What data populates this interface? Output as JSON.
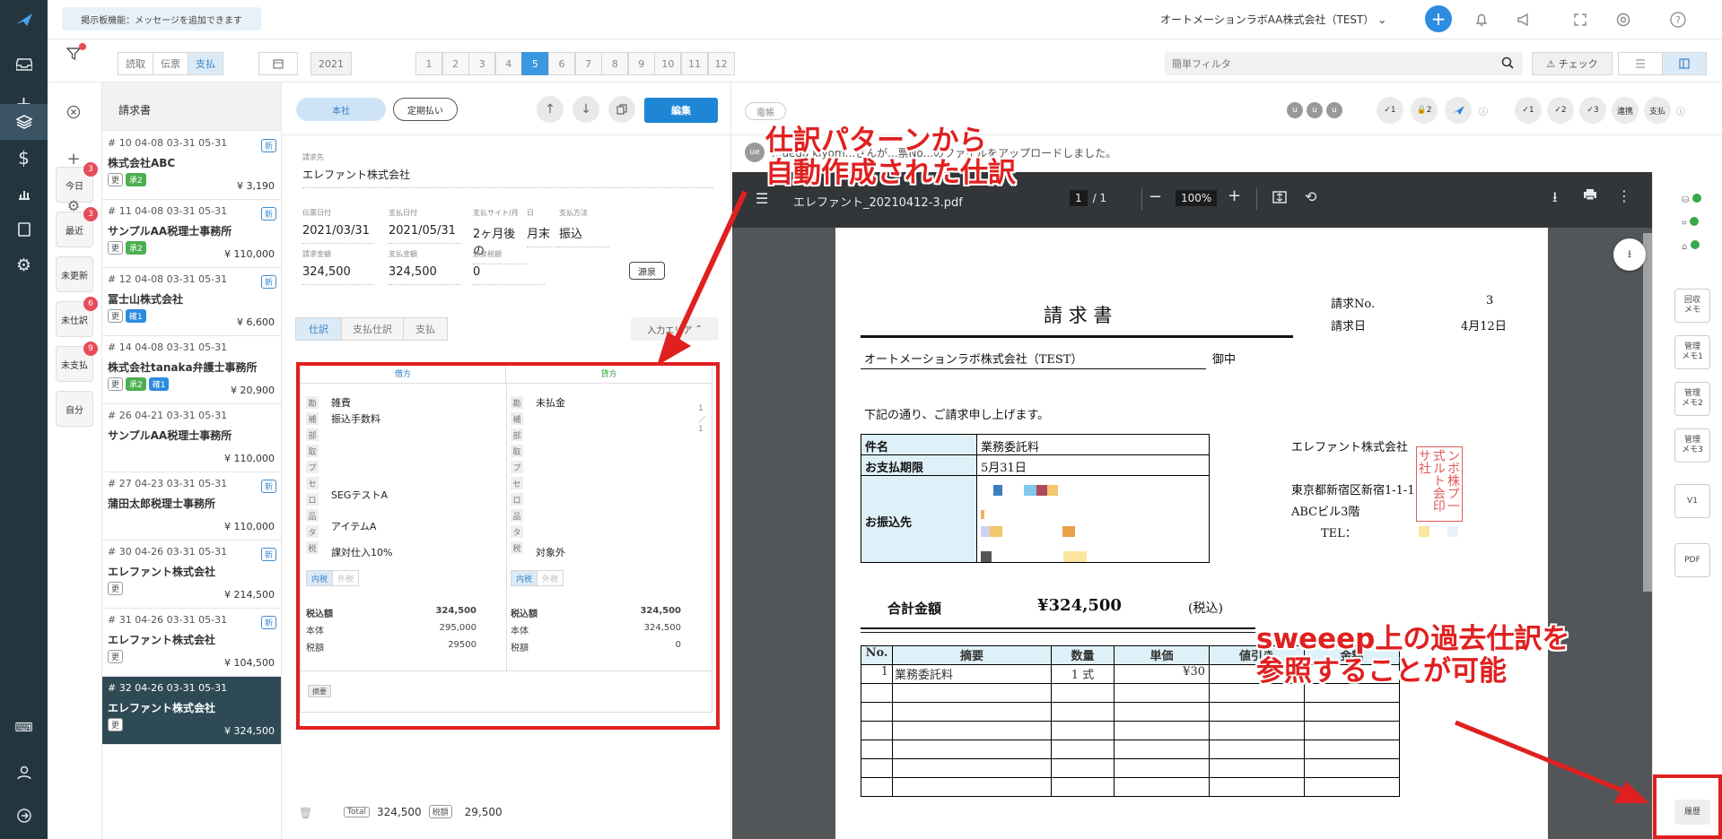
{
  "topbar": {
    "notice": "掲示板機能：メッセージを追加できます",
    "company": "オートメーションラボAA株式会社（TEST）",
    "accent": "#2d8be0"
  },
  "filterbar": {
    "modes": [
      "読取",
      "伝票",
      "支払"
    ],
    "year": "2021",
    "months": [
      "1",
      "2",
      "3",
      "4",
      "5",
      "6",
      "7",
      "8",
      "9",
      "10",
      "11",
      "12"
    ],
    "active_month": "5",
    "search_placeholder": "簡単フィルタ",
    "check_label": "チェック"
  },
  "quickfilters": [
    {
      "label": "今日",
      "badge": "3"
    },
    {
      "label": "最近",
      "badge": "3"
    },
    {
      "label": "未更新",
      "badge": ""
    },
    {
      "label": "未仕訳",
      "badge": "6"
    },
    {
      "label": "未支払",
      "badge": "9"
    },
    {
      "label": "自分",
      "badge": ""
    }
  ],
  "list": {
    "header": "請求書",
    "items": [
      {
        "meta": "# 10   04-08   03-31   05-31",
        "name": "株式会社ABC",
        "tags": [
          "更",
          "承2"
        ],
        "amount": "¥ 3,190",
        "new": "新"
      },
      {
        "meta": "# 11   04-08   03-31   05-31",
        "name": "サンプルAA税理士事務所",
        "tags": [
          "更",
          "承2"
        ],
        "amount": "¥ 110,000",
        "new": "新"
      },
      {
        "meta": "# 12   04-08   03-31   05-31",
        "name": "冨士山株式会社",
        "tags": [
          "更",
          "確1"
        ],
        "amount": "¥ 6,600",
        "new": "新"
      },
      {
        "meta": "# 14   04-08   03-31   05-31",
        "name": "株式会社tanaka弁護士事務所",
        "tags": [
          "更",
          "承2",
          "確1"
        ],
        "amount": "¥ 20,900",
        "new": ""
      },
      {
        "meta": "# 26   04-21   03-31   05-31",
        "name": "サンプルAA税理士事務所",
        "tags": [],
        "amount": "¥ 110,000",
        "new": ""
      },
      {
        "meta": "# 27   04-23   03-31   05-31",
        "name": "蒲田太郎税理士事務所",
        "tags": [],
        "amount": "¥ 110,000",
        "new": "新"
      },
      {
        "meta": "# 30   04-26   03-31   05-31",
        "name": "エレファント株式会社",
        "tags": [
          "更"
        ],
        "amount": "¥ 214,500",
        "new": "新"
      },
      {
        "meta": "# 31   04-26   03-31   05-31",
        "name": "エレファント株式会社",
        "tags": [
          "更"
        ],
        "amount": "¥ 104,500",
        "new": "新"
      },
      {
        "meta": "# 32   04-26   03-31   05-31",
        "name": "エレファント株式会社",
        "tags": [
          "更"
        ],
        "amount": "¥ 324,500",
        "new": ""
      }
    ]
  },
  "detail": {
    "btn_company": "本社",
    "btn_recurring": "定期払い",
    "btn_edit": "編集",
    "payee_label": "請求先",
    "payee": "エレファント株式会社",
    "fields": [
      {
        "label": "伝票日付",
        "value": "2021/03/31"
      },
      {
        "label": "支払日付",
        "value": "2021/05/31"
      },
      {
        "label": "支払サイト/月",
        "value": "2ヶ月後の"
      },
      {
        "label": "日",
        "value": "月末"
      },
      {
        "label": "支払方法",
        "value": "振込"
      },
      {
        "label": "請求金額",
        "value": "324,500"
      },
      {
        "label": "支払金額",
        "value": "324,500"
      },
      {
        "label": "源泉税額",
        "value": "0"
      }
    ],
    "gensen": "源泉",
    "tabs": [
      "仕訳",
      "支払仕訳",
      "支払"
    ],
    "input_btn": "入力エリア",
    "debit_header": "借方",
    "credit_header": "貸方",
    "row_labels": [
      "勘",
      "補",
      "部",
      "取",
      "プ",
      "セ",
      "ロ",
      "品",
      "タ",
      "税"
    ],
    "debit": {
      "account": "雑費",
      "sub": "振込手数料",
      "segment": "SEGテストA",
      "item": "アイテムA",
      "tax": "課対仕入10%"
    },
    "credit": {
      "account": "未払金",
      "tax": "対象外"
    },
    "tax_toggle": [
      "内税",
      "外税"
    ],
    "sum_labels": [
      "税込額",
      "本体",
      "税額"
    ],
    "debit_sums": [
      "324,500",
      "295,000",
      "29500"
    ],
    "credit_sums": [
      "324,500",
      "324,500",
      "0"
    ],
    "memo": "摘要",
    "total_label": "Total",
    "total": "324,500",
    "tax_label": "税額",
    "tax_total": "29,500"
  },
  "viewer": {
    "ledger_btn": "電帳",
    "comment_avatar": "ue",
    "comment": "...ueda kiyom...さんが...票No...のファイルをアップロードしました。",
    "approvals": [
      "1",
      "2",
      "1",
      "2",
      "3"
    ],
    "quick_labels": [
      "連携",
      "支払"
    ],
    "pdf_name": "エレファント_20210412-3.pdf",
    "page_current": "1",
    "page_total": "/ 1",
    "zoom": "100%"
  },
  "invoice": {
    "title": "請 求 書",
    "no_label": "請求No.",
    "no": "3",
    "date_label": "請求日",
    "date": "4月12日",
    "to": "オートメーションラボ株式会社（TEST）",
    "to_suffix": "御中",
    "greeting": "下記の通り、ご請求申し上げます。",
    "rows": [
      {
        "label": "件名",
        "value": "業務委託料"
      },
      {
        "label": "お支払期限",
        "value": "5月31日"
      },
      {
        "label": "お振込先",
        "value": ""
      }
    ],
    "issuer": "エレファント株式会社",
    "address": "東京都新宿区新宿1-1-1",
    "building": "ABCビル3階",
    "tel": "TEL：",
    "seal": "ンボ株プ一式ルト会印サ社",
    "total_label": "合計金額",
    "total": "¥324,500",
    "total_note": "(税込)",
    "cols": [
      "No.",
      "摘要",
      "数量",
      "単価",
      "値引き",
      "金額"
    ],
    "line1": {
      "no": "1",
      "desc": "業務委託料",
      "qty": "1 式",
      "price": "¥30"
    }
  },
  "rstrip": {
    "buttons": [
      "回収\nメモ",
      "管理\nメモ1",
      "管理\nメモ2",
      "管理\nメモ3",
      "V1",
      "PDF",
      "履歴"
    ]
  },
  "annotations": {
    "top": "仕訳パターンから\n自動作成された仕訳",
    "bottom": "sweeep上の過去仕訳を\n参照することが可能"
  }
}
